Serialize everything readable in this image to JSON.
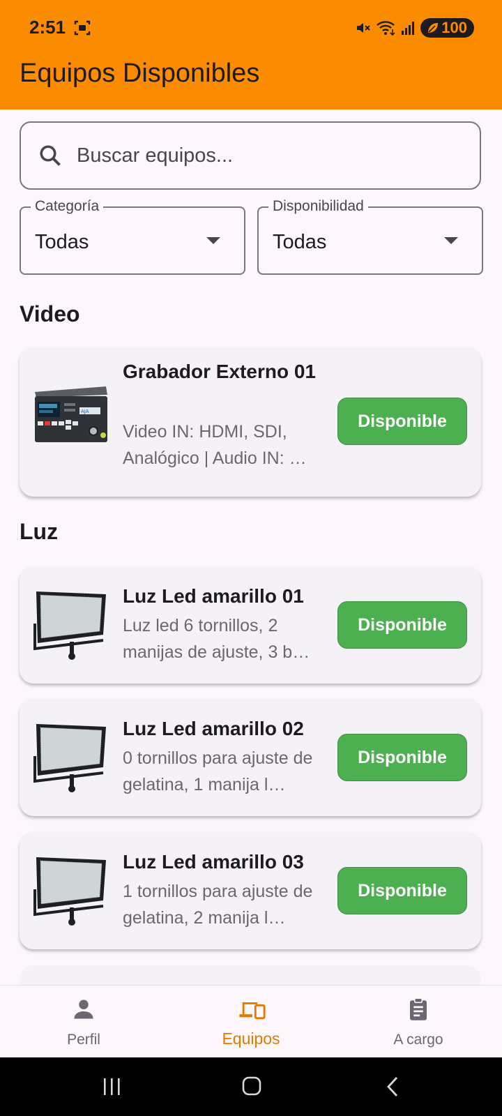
{
  "status_bar": {
    "time": "2:51",
    "battery": "100"
  },
  "app_bar": {
    "title": "Equipos Disponibles"
  },
  "search": {
    "placeholder": "Buscar equipos..."
  },
  "filters": {
    "category": {
      "label": "Categoría",
      "value": "Todas"
    },
    "availability": {
      "label": "Disponibilidad",
      "value": "Todas"
    }
  },
  "sections": [
    {
      "title": "Video",
      "items": [
        {
          "title": "Grabador Externo 01",
          "description": "Video IN: HDMI, SDI, Analógico | Audio IN: …",
          "status": "Disponible",
          "thumb": "recorder-image"
        }
      ]
    },
    {
      "title": "Luz",
      "items": [
        {
          "title": "Luz Led amarillo 01",
          "description": "Luz led 6 tornillos, 2 manijas de ajuste, 3 b…",
          "status": "Disponible",
          "thumb": "led-panel-image"
        },
        {
          "title": "Luz Led amarillo 02",
          "description": "0 tornillos para ajuste de gelatina, 1 manija l…",
          "status": "Disponible",
          "thumb": "led-panel-image"
        },
        {
          "title": "Luz Led amarillo 03",
          "description": "1 tornillos para ajuste de gelatina, 2 manija l…",
          "status": "Disponible",
          "thumb": "led-panel-image"
        }
      ]
    }
  ],
  "bottom_nav": [
    {
      "label": "Perfil",
      "icon": "person-icon",
      "active": false
    },
    {
      "label": "Equipos",
      "icon": "devices-icon",
      "active": true
    },
    {
      "label": "A cargo",
      "icon": "clipboard-icon",
      "active": false
    }
  ],
  "colors": {
    "app_bar": "#fb8c00",
    "available": "#4caf50",
    "active_nav": "#e07b00"
  }
}
